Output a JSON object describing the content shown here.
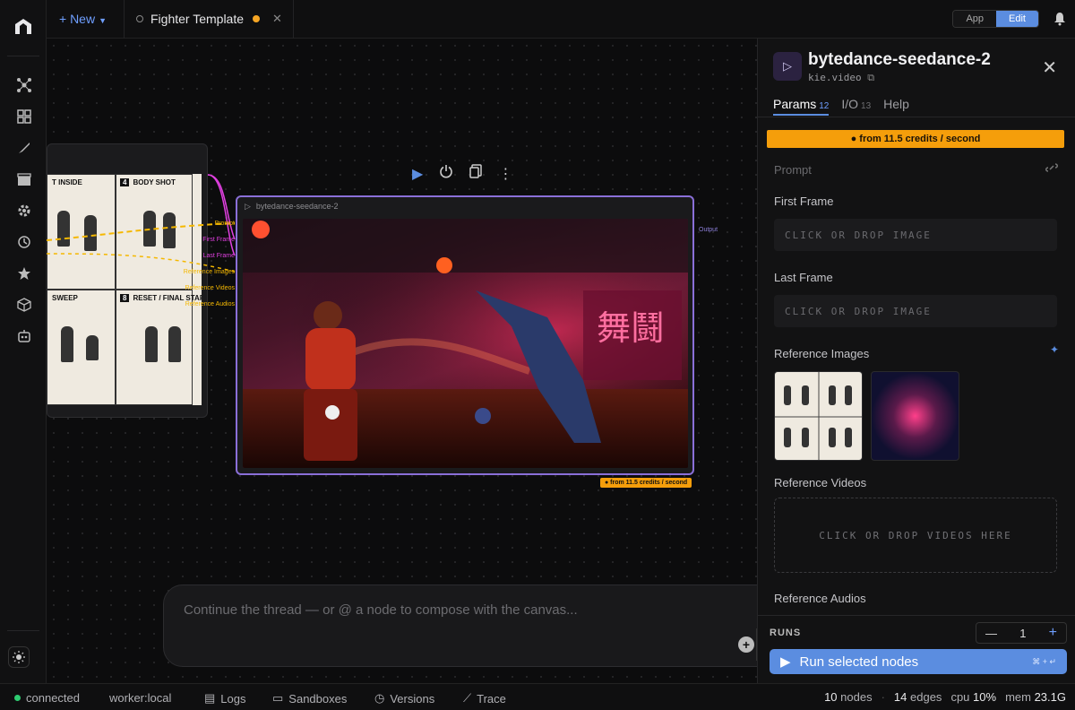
{
  "topbar": {
    "new_label": "+ New",
    "tab_title": "Fighter Template",
    "mode_app": "App",
    "mode_edit": "Edit"
  },
  "canvas": {
    "node_ports": [
      "Prompt",
      "First Frame",
      "Last Frame",
      "Reference Images",
      "Reference Videos",
      "Reference Audios"
    ],
    "storyboard_captions": [
      "T INSIDE",
      "BODY SHOT",
      "SWEEP",
      "RESET / FINAL STAREDOWN"
    ],
    "storyboard_numbers": [
      "4",
      "8"
    ],
    "video_node_title": "bytedance-seedance-2",
    "output_label": "Output",
    "credit_tag": "● from 11.5 credits / second",
    "chat_placeholder": "Continue the thread — or @ a node to compose with the canvas..."
  },
  "panel": {
    "title": "bytedance-seedance-2",
    "subtitle": "kie.video",
    "tabs": [
      {
        "label": "Params",
        "count": "12"
      },
      {
        "label": "I/O",
        "count": "13"
      },
      {
        "label": "Help",
        "count": ""
      }
    ],
    "credits": "● from 11.5 credits / second",
    "prompt_label": "Prompt",
    "first_frame_label": "First Frame",
    "first_frame_drop": "CLICK OR DROP IMAGE",
    "last_frame_label": "Last Frame",
    "last_frame_drop": "CLICK OR DROP IMAGE",
    "ref_images_label": "Reference Images",
    "ref_videos_label": "Reference Videos",
    "ref_videos_drop": "CLICK OR DROP VIDEOS HERE",
    "ref_audios_label": "Reference Audios",
    "runs_label": "RUNS",
    "runs_value": "1",
    "run_button": "Run selected nodes",
    "run_shortcut": "⌘ + ↵"
  },
  "status": {
    "connected": "connected",
    "worker": "worker:local",
    "logs": "Logs",
    "sandboxes": "Sandboxes",
    "versions": "Versions",
    "trace": "Trace",
    "nodes_count": "10",
    "nodes_label": "nodes",
    "edges_count": "14",
    "edges_label": "edges",
    "cpu_label": "cpu",
    "cpu_value": "10%",
    "mem_label": "mem",
    "mem_value": "23.1G"
  },
  "colors": {
    "accent": "#5b8de0",
    "credit": "#f59e0b",
    "node_border": "#8a6fd8",
    "status_ok": "#2ecc71"
  }
}
